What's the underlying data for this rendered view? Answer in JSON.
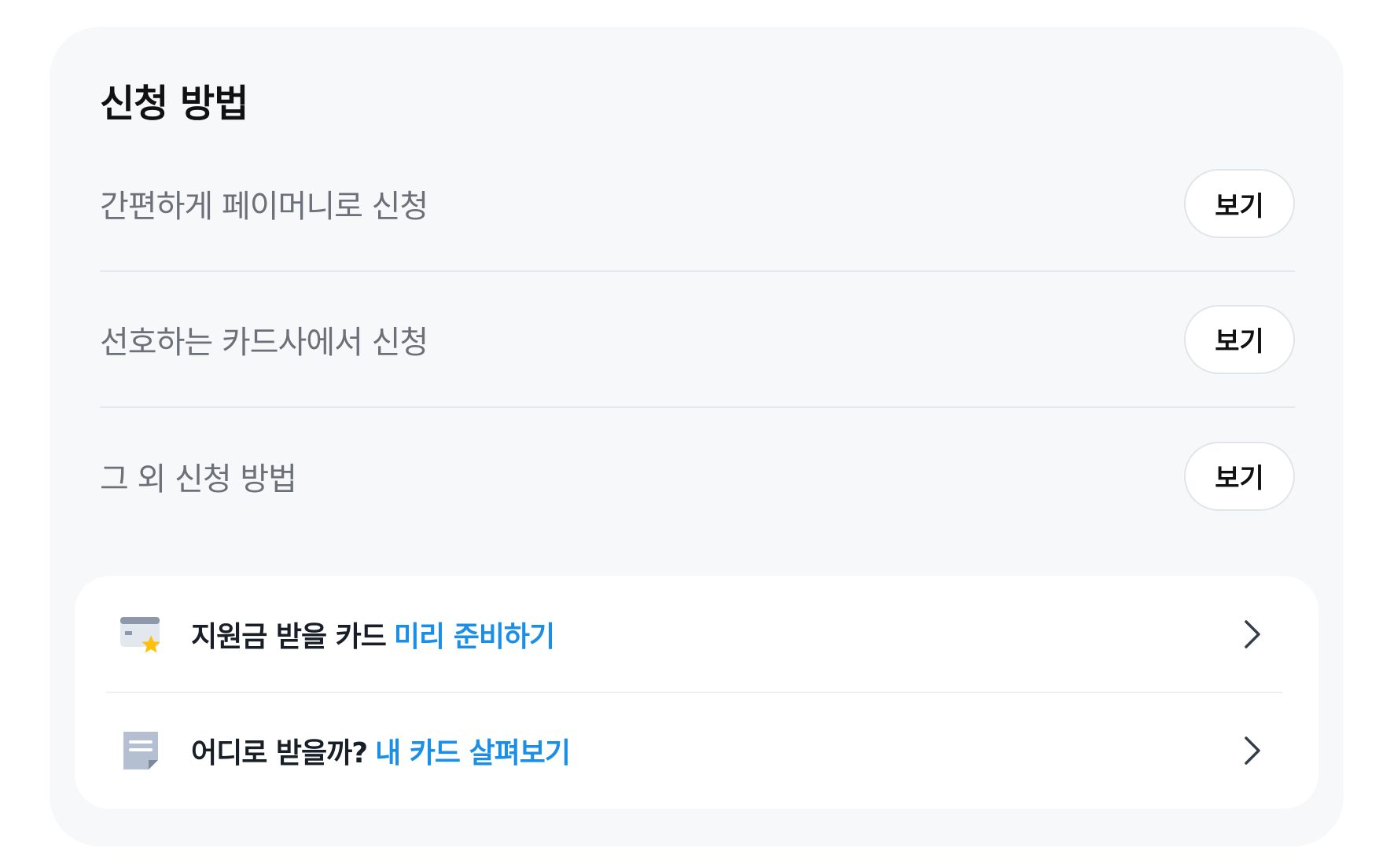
{
  "section": {
    "title": "신청 방법",
    "items": [
      {
        "label": "간편하게 페이머니로 신청",
        "button": "보기"
      },
      {
        "label": "선호하는 카드사에서 신청",
        "button": "보기"
      },
      {
        "label": "그 외 신청 방법",
        "button": "보기"
      }
    ]
  },
  "links": [
    {
      "text": "지원금 받을 카드",
      "accent": "미리 준비하기",
      "icon": "card-star-icon"
    },
    {
      "text": "어디로 받을까?",
      "accent": "내 카드 살펴보기",
      "icon": "memo-icon"
    }
  ],
  "colors": {
    "accent": "#1b8ee8",
    "panel_bg": "#f7f8fa",
    "label_gray": "#6b7079",
    "star": "#ffc107"
  }
}
